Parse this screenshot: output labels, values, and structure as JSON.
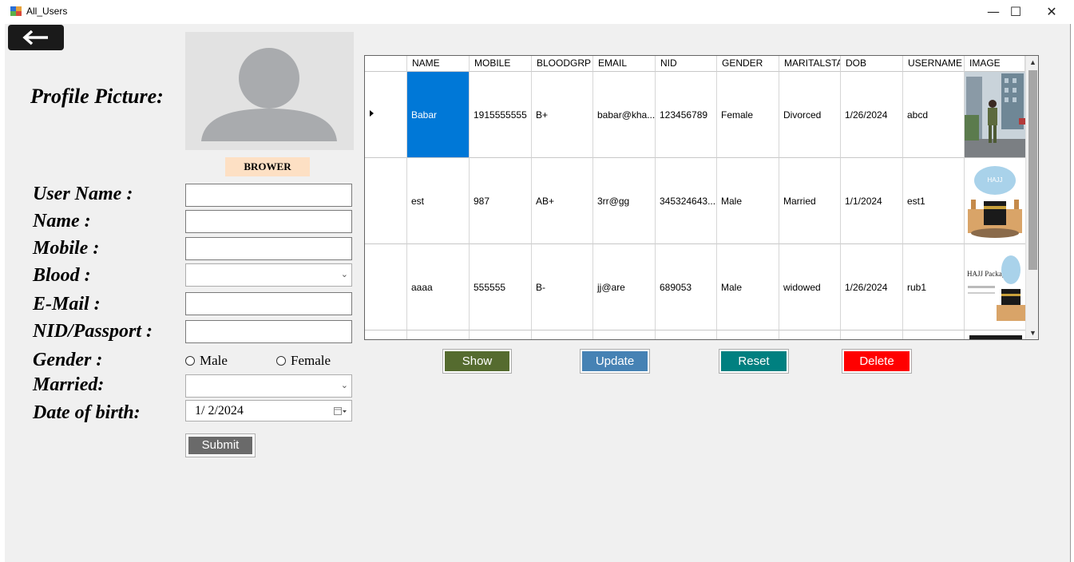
{
  "window": {
    "title": "All_Users",
    "minimize_glyph": "—",
    "maximize_glyph": "☐",
    "close_glyph": "✕"
  },
  "back_button": {
    "icon": "arrow-left-icon"
  },
  "profile": {
    "label": "Profile Picture:",
    "browse_label": "BROWER"
  },
  "form": {
    "username_label": "User Name :",
    "name_label": "Name  :",
    "mobile_label": "Mobile  :",
    "blood_label": "Blood   :",
    "email_label": "E-Mail  :",
    "nid_label": "NID/Passport :",
    "gender_label": "Gender :",
    "married_label": "Married:",
    "dob_label": "Date of birth:",
    "username_value": "",
    "name_value": "",
    "mobile_value": "",
    "blood_value": "",
    "email_value": "",
    "nid_value": "",
    "married_value": "",
    "gender_options": [
      "Male",
      "Female"
    ],
    "dob_value": "1/  2/2024",
    "submit_label": "Submit"
  },
  "grid": {
    "columns": [
      "NAME",
      "MOBILE",
      "BLOODGRP",
      "EMAIL",
      "NID",
      "GENDER",
      "MARITALSTA",
      "DOB",
      "USERNAME",
      "IMAGE"
    ],
    "rows": [
      {
        "name": "Babar",
        "mobile": "1915555555",
        "bloodgrp": "B+",
        "email": "babar@kha...",
        "nid": "123456789",
        "gender": "Female",
        "marital": "Divorced",
        "dob": "1/26/2024",
        "username": "abcd"
      },
      {
        "name": "est",
        "mobile": "987",
        "bloodgrp": "AB+",
        "email": "3rr@gg",
        "nid": "345324643...",
        "gender": "Male",
        "marital": "Married",
        "dob": "1/1/2024",
        "username": "est1"
      },
      {
        "name": "aaaa",
        "mobile": "555555",
        "bloodgrp": "B-",
        "email": "jj@are",
        "nid": "689053",
        "gender": "Male",
        "marital": "widowed",
        "dob": "1/26/2024",
        "username": "rub1"
      }
    ],
    "image_texts": [
      "HAJJ",
      "HAJJ Package"
    ]
  },
  "actions": {
    "show": "Show",
    "update": "Update",
    "reset": "Reset",
    "delete": "Delete"
  },
  "colors": {
    "show": "#556b2f",
    "update": "#4682b4",
    "reset": "#008080",
    "delete": "#ff0000",
    "selection": "#0078d7"
  }
}
